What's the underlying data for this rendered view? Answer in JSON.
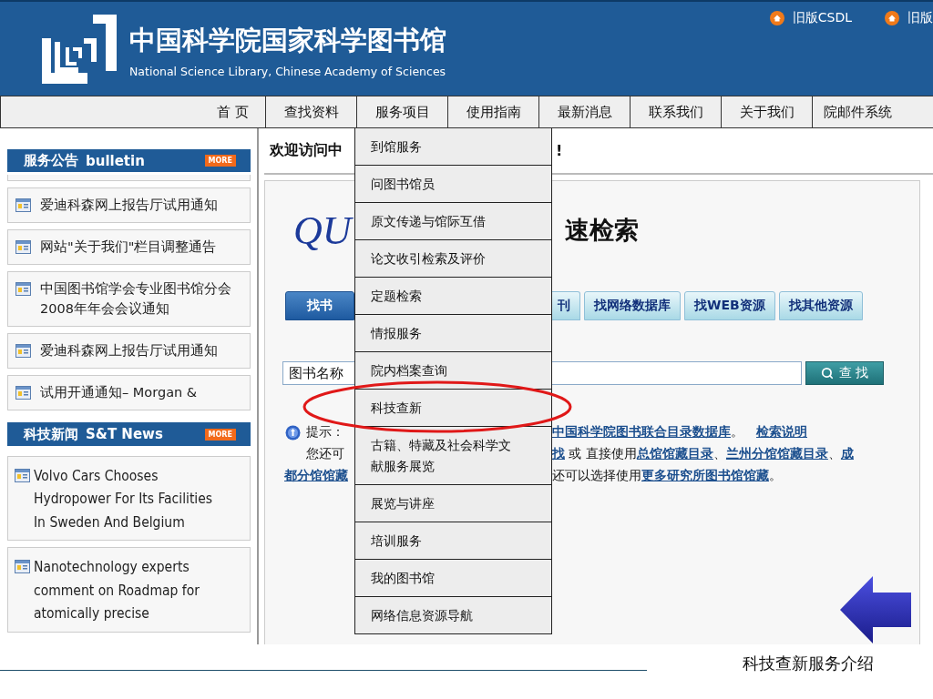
{
  "header": {
    "title": "中国科学院国家科学图书馆",
    "subtitle": "National Science Library, Chinese Academy of Sciences",
    "links": [
      "旧版CSDL",
      "旧版"
    ]
  },
  "nav": {
    "items": [
      "首 页",
      "查找资料",
      "服务项目",
      "使用指南",
      "最新消息",
      "联系我们",
      "关于我们",
      "院邮件系统"
    ]
  },
  "dropdown": {
    "items": [
      [
        "到馆服务"
      ],
      [
        "问图书馆员"
      ],
      [
        "原文传递与馆际互借"
      ],
      [
        "论文收引检索及评价"
      ],
      [
        "定题检索"
      ],
      [
        "情报服务"
      ],
      [
        "院内档案查询"
      ],
      [
        "科技查新"
      ],
      [
        "古籍、特藏及社会科学文",
        "献服务展览"
      ],
      [
        "展览与讲座"
      ],
      [
        "培训服务"
      ],
      [
        "我的图书馆"
      ],
      [
        "网络信息资源导航"
      ]
    ]
  },
  "sidebar": {
    "sections": [
      {
        "title": "服务公告",
        "title_en": "bulletin",
        "more": "MORE",
        "items": [
          [
            "爱迪科森网上报告厅试用通知"
          ],
          [
            "网站\"关于我们\"栏目调整通告"
          ],
          [
            "中国图书馆学会专业图书馆分会",
            "2008年年会会议通知"
          ],
          [
            "爱迪科森网上报告厅试用通知"
          ],
          [
            "试用开通通知– Morgan &"
          ]
        ]
      },
      {
        "title": "科技新闻",
        "title_en": "S&T News",
        "more": "MORE",
        "items": [
          [
            "Volvo Cars Chooses",
            "Hydropower For Its Facilities",
            "In Sweden And Belgium"
          ],
          [
            "Nanotechnology experts",
            "comment on Roadmap for",
            "atomically precise"
          ]
        ]
      }
    ]
  },
  "main": {
    "heading_parts": [
      "欢迎访问中",
      "!"
    ],
    "search_logo": "QU",
    "search_title": "速检索",
    "tabs": [
      {
        "label": "找书",
        "selected": true
      },
      {
        "label": "刊",
        "selected": false
      },
      {
        "label": "找网络数据库",
        "selected": false
      },
      {
        "label": "找WEB资源",
        "selected": false
      },
      {
        "label": "找其他资源",
        "selected": false
      }
    ],
    "search": {
      "field_label": "图书名称",
      "button": "查 找"
    },
    "hint_lines": [
      {
        "left": [
          {
            "text": "提示：",
            "link": false
          }
        ],
        "right": [
          {
            "text": "中国科学院图书联合目录数据库",
            "link": true
          },
          {
            "text": "。",
            "link": false
          },
          {
            "text": "检索说明",
            "link": true
          }
        ]
      },
      {
        "left": [
          {
            "text": "您还可",
            "link": false
          }
        ],
        "right": [
          {
            "text": "找",
            "link": true
          },
          {
            "text": " 或 直接使用",
            "link": false
          },
          {
            "text": "总馆馆藏目录",
            "link": true
          },
          {
            "text": "、",
            "link": false
          },
          {
            "text": "兰州分馆馆藏目录",
            "link": true
          },
          {
            "text": "、",
            "link": false
          },
          {
            "text": "成",
            "link": true
          }
        ]
      },
      {
        "left": [
          {
            "text": "都分馆馆藏",
            "link": true
          }
        ],
        "right": [
          {
            "text": "还可以选择使用",
            "link": false
          },
          {
            "text": "更多研究所图书馆馆藏",
            "link": true
          },
          {
            "text": "。",
            "link": false
          }
        ]
      }
    ]
  },
  "slide": {
    "caption": "科技查新服务介绍"
  }
}
